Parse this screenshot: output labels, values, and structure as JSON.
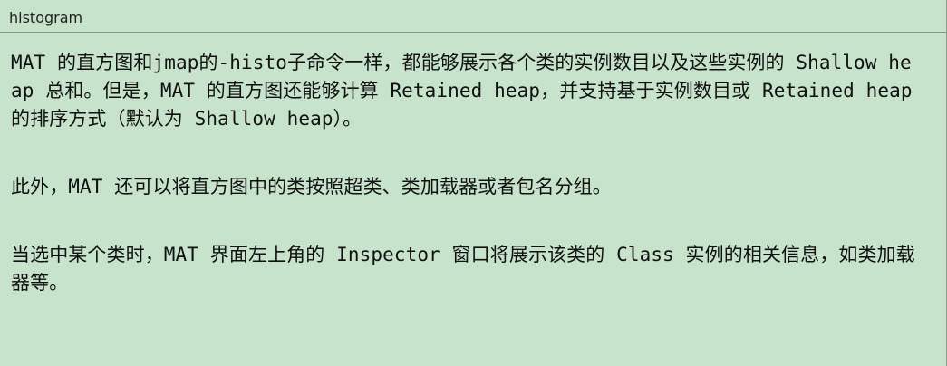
{
  "window": {
    "title": "histogram"
  },
  "content": {
    "paragraphs": [
      "MAT 的直方图和jmap的-histo子命令一样，都能够展示各个类的实例数目以及这些实例的 Shallow heap 总和。但是，MAT 的直方图还能够计算 Retained heap，并支持基于实例数目或 Retained heap 的排序方式（默认为 Shallow heap）。",
      "此外，MAT 还可以将直方图中的类按照超类、类加载器或者包名分组。",
      "当选中某个类时，MAT 界面左上角的 Inspector 窗口将展示该类的 Class 实例的相关信息，如类加载器等。"
    ]
  }
}
